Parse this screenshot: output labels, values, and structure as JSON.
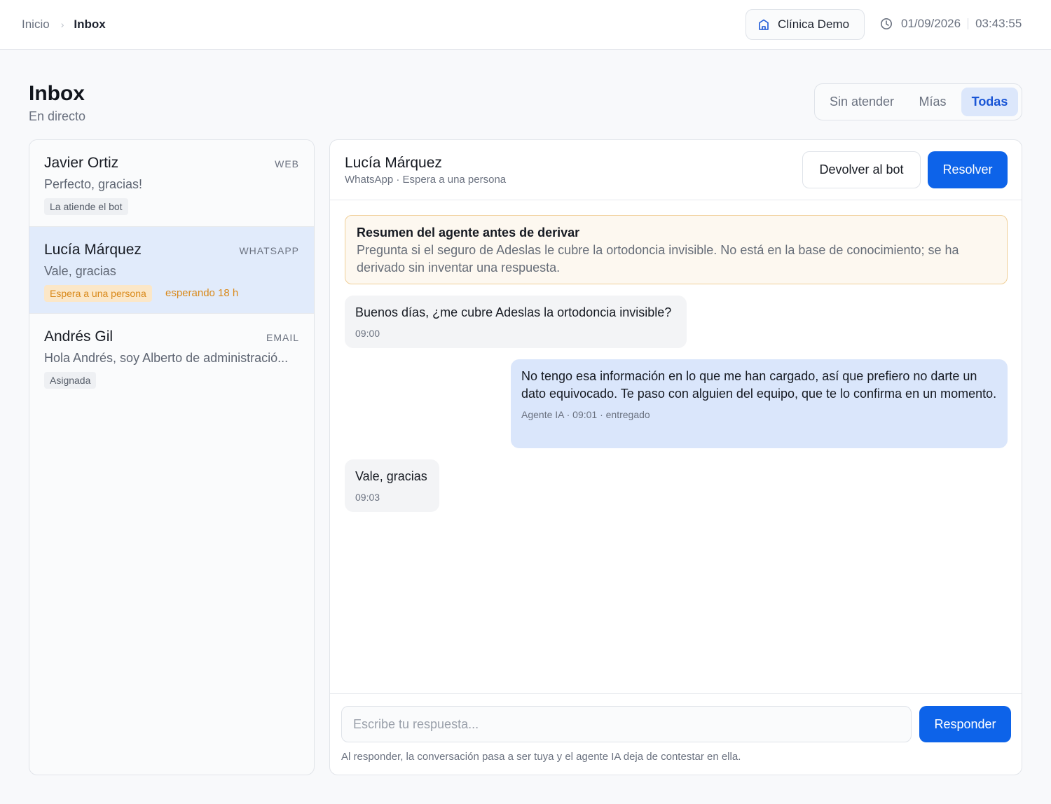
{
  "breadcrumb": {
    "home": "Inicio",
    "separator": "›",
    "current": "Inbox"
  },
  "clinic": {
    "name": "Clínica Demo",
    "icon": "building-icon"
  },
  "datetime": {
    "date": "01/09/2026",
    "time": "03:43:55",
    "icon": "clock-icon"
  },
  "header": {
    "title": "Inbox",
    "subtitle": "En directo"
  },
  "filters": {
    "tabs": [
      "Sin atender",
      "Mías",
      "Todas"
    ],
    "selected": "Todas"
  },
  "conversations": [
    {
      "name": "Javier Ortiz",
      "channel": "WEB",
      "preview": "Perfecto, gracias!",
      "tag": "La atiende el bot",
      "wait": ""
    },
    {
      "name": "Lucía Márquez",
      "channel": "WHATSAPP",
      "preview": "Vale, gracias",
      "tag": "Espera a una persona",
      "wait": "esperando 18 h"
    },
    {
      "name": "Andrés Gil",
      "channel": "EMAIL",
      "preview": "Hola Andrés, soy Alberto de administració...",
      "tag": "Asignada",
      "wait": ""
    }
  ],
  "chat": {
    "name": "Lucía Márquez",
    "subtitle": "WhatsApp · Espera a una persona",
    "return_label": "Devolver al bot",
    "resolve_label": "Resolver",
    "summary": {
      "title": "Resumen del agente antes de derivar",
      "text": "Pregunta si el seguro de Adeslas le cubre la ortodoncia invisible. No está en la base de conocimiento; se ha derivado sin inventar una respuesta."
    },
    "messages": [
      {
        "text": "Buenos días, ¿me cubre Adeslas la ortodoncia invisible?",
        "meta": "09:00"
      },
      {
        "text": "No tengo esa información en lo que me han cargado, así que prefiero no darte un dato equivocado. Te paso con alguien del equipo, que te lo confirma en un momento.",
        "meta": "Agente IA · 09:01 · entregado"
      },
      {
        "text": "Vale, gracias",
        "meta": "09:03"
      }
    ],
    "composer": {
      "placeholder": "Escribe tu respuesta...",
      "value": "",
      "button_label": "Responder",
      "note": "Al responder, la conversación pasa a ser tuya y el agente IA deja de contestar en ella."
    }
  },
  "colors": {
    "accent": "#0d63e9",
    "selected_bg": "#e1ebfb",
    "warning": "#d9891a",
    "summary_border": "#f0cf98"
  }
}
